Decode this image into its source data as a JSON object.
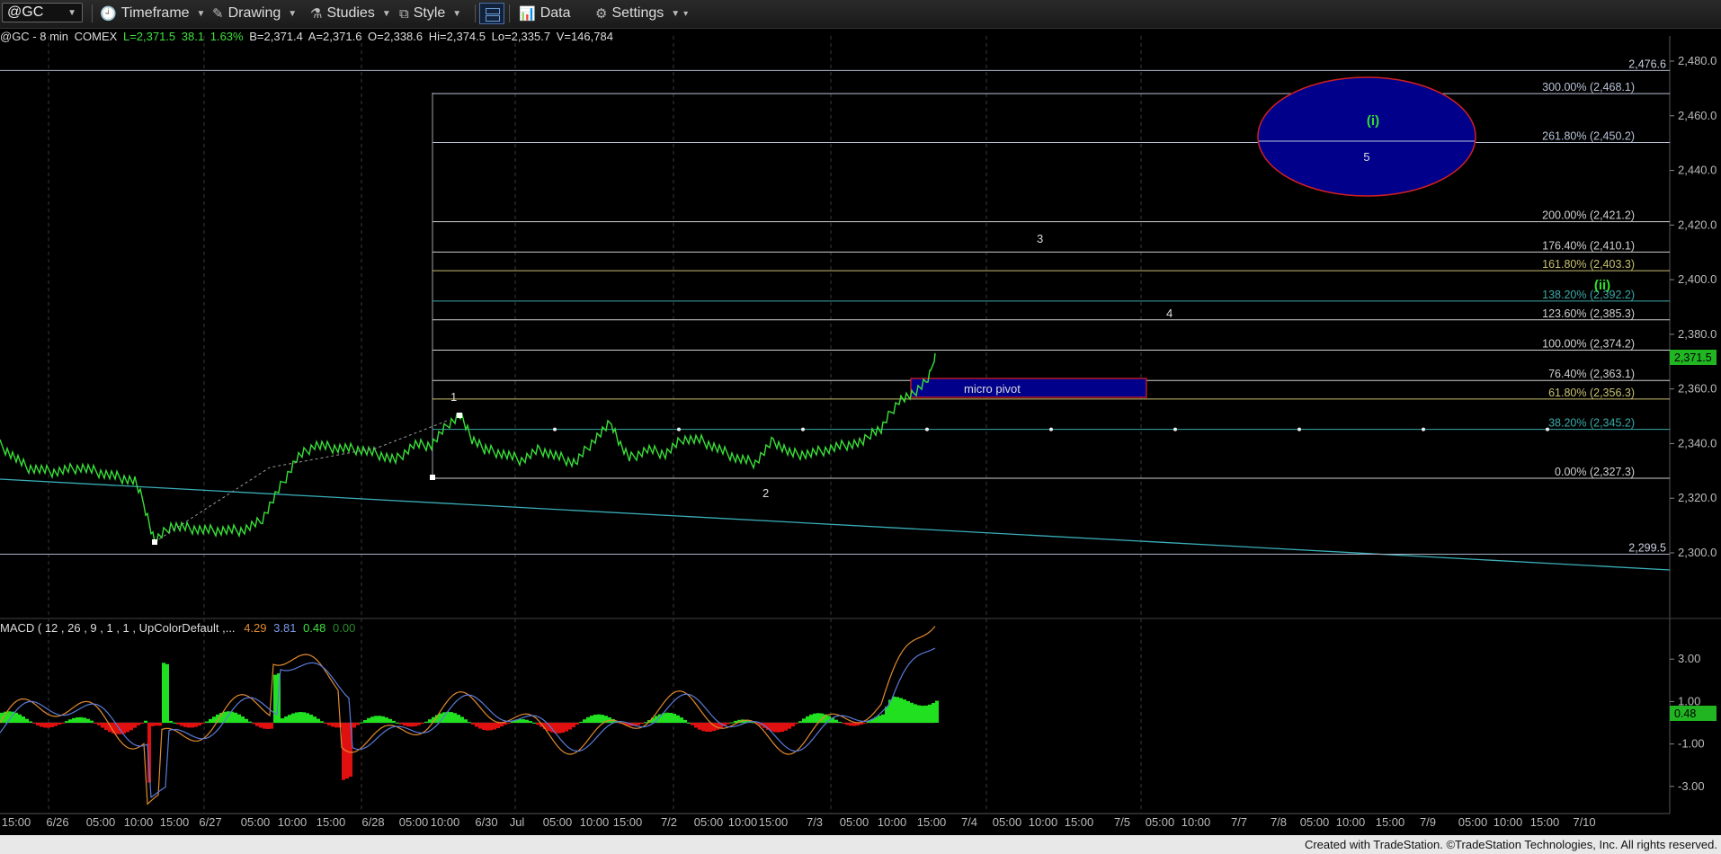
{
  "toolbar": {
    "symbol": "@GC",
    "timeframe": "Timeframe",
    "drawing": "Drawing",
    "studies": "Studies",
    "style": "Style",
    "data": "Data",
    "settings": "Settings"
  },
  "quote": {
    "name": "@GC - 8 min",
    "exchange": "COMEX",
    "last": "L=2,371.5",
    "change": "38.1",
    "change_pct": "1.63%",
    "bid": "B=2,371.4",
    "ask": "A=2,371.6",
    "open": "O=2,338.6",
    "high": "Hi=2,374.5",
    "low": "Lo=2,335.7",
    "volume": "V=146,784"
  },
  "price_axis": {
    "ticks": [
      "2,480.0",
      "2,460.0",
      "2,440.0",
      "2,420.0",
      "2,400.0",
      "2,380.0",
      "2,360.0",
      "2,340.0",
      "2,320.0",
      "2,300.0"
    ],
    "last_price": "2,371.5"
  },
  "fib_levels": [
    {
      "label": "300.00% (2,468.1)",
      "price": 2468.1,
      "color": "#b8c4d6"
    },
    {
      "label": "261.80% (2,450.2)",
      "price": 2450.2,
      "color": "#b8c4d6"
    },
    {
      "label": "200.00% (2,421.2)",
      "price": 2421.2,
      "color": "#d0d0d0"
    },
    {
      "label": "176.40% (2,410.1)",
      "price": 2410.1,
      "color": "#d0d0d0"
    },
    {
      "label": "161.80% (2,403.3)",
      "price": 2403.3,
      "color": "#c8c070"
    },
    {
      "label": "138.20% (2,392.2)",
      "price": 2392.2,
      "color": "#3aa8a8"
    },
    {
      "label": "123.60% (2,385.3)",
      "price": 2385.3,
      "color": "#d0d0d0"
    },
    {
      "label": "100.00% (2,374.2)",
      "price": 2374.2,
      "color": "#d0d0d0"
    },
    {
      "label": "76.40% (2,363.1)",
      "price": 2363.1,
      "color": "#d0d0d0"
    },
    {
      "label": "61.80% (2,356.3)",
      "price": 2356.3,
      "color": "#c8c070"
    },
    {
      "label": "38.20% (2,345.2)",
      "price": 2345.2,
      "color": "#3aa8a8"
    },
    {
      "label": "0.00% (2,327.3)",
      "price": 2327.3,
      "color": "#d0d0d0"
    }
  ],
  "hlines": [
    {
      "label": "2,476.6",
      "price": 2476.6
    },
    {
      "label": "2,299.5",
      "price": 2299.5
    }
  ],
  "annotations": {
    "wave_1": "1",
    "wave_2": "2",
    "wave_3": "3",
    "wave_4": "4",
    "wave_5": "5",
    "wave_i": "(i)",
    "wave_ii": "(ii)",
    "micro_pivot": "micro pivot"
  },
  "macd": {
    "title": "MACD ( 12 , 26 , 9 , 1 , 1 , UpColorDefault ,...",
    "macd_val": "4.29",
    "signal_val": "3.81",
    "hist_val": "0.48",
    "zero_val": "0.00",
    "axis_ticks": [
      "3.00",
      "1.00",
      "-1.00",
      "-3.00"
    ],
    "last_hist": "0.48"
  },
  "time_axis": [
    "15:00",
    "6/26",
    "05:00",
    "10:00",
    "15:00",
    "6/27",
    "05:00",
    "10:00",
    "15:00",
    "6/28",
    "05:00",
    "10:00",
    "6/30",
    "Jul",
    "05:00",
    "10:00",
    "15:00",
    "7/2",
    "05:00",
    "10:00",
    "15:00",
    "7/3",
    "05:00",
    "10:00",
    "15:00",
    "7/4",
    "05:00",
    "10:00",
    "15:00",
    "7/5",
    "05:00",
    "10:00",
    "7/7",
    "7/8",
    "05:00",
    "10:00",
    "15:00",
    "7/9",
    "05:00",
    "10:00",
    "15:00",
    "7/10"
  ],
  "colors": {
    "price_bars": "#38e038",
    "fib_box": "#9aa0a8",
    "trendline": "#40b8c0",
    "ellipse_fill": "#00008b",
    "ellipse_stroke": "#d02020",
    "pivot_fill": "#00008b",
    "pivot_stroke": "#d02020",
    "wave_i_color": "#30e030",
    "macd_line": "#e08a30",
    "signal_line": "#5a7ad8",
    "hist_pos": "#20e020",
    "hist_neg": "#e01010"
  },
  "footer": "Created with TradeStation. ©TradeStation Technologies, Inc. All rights reserved."
}
